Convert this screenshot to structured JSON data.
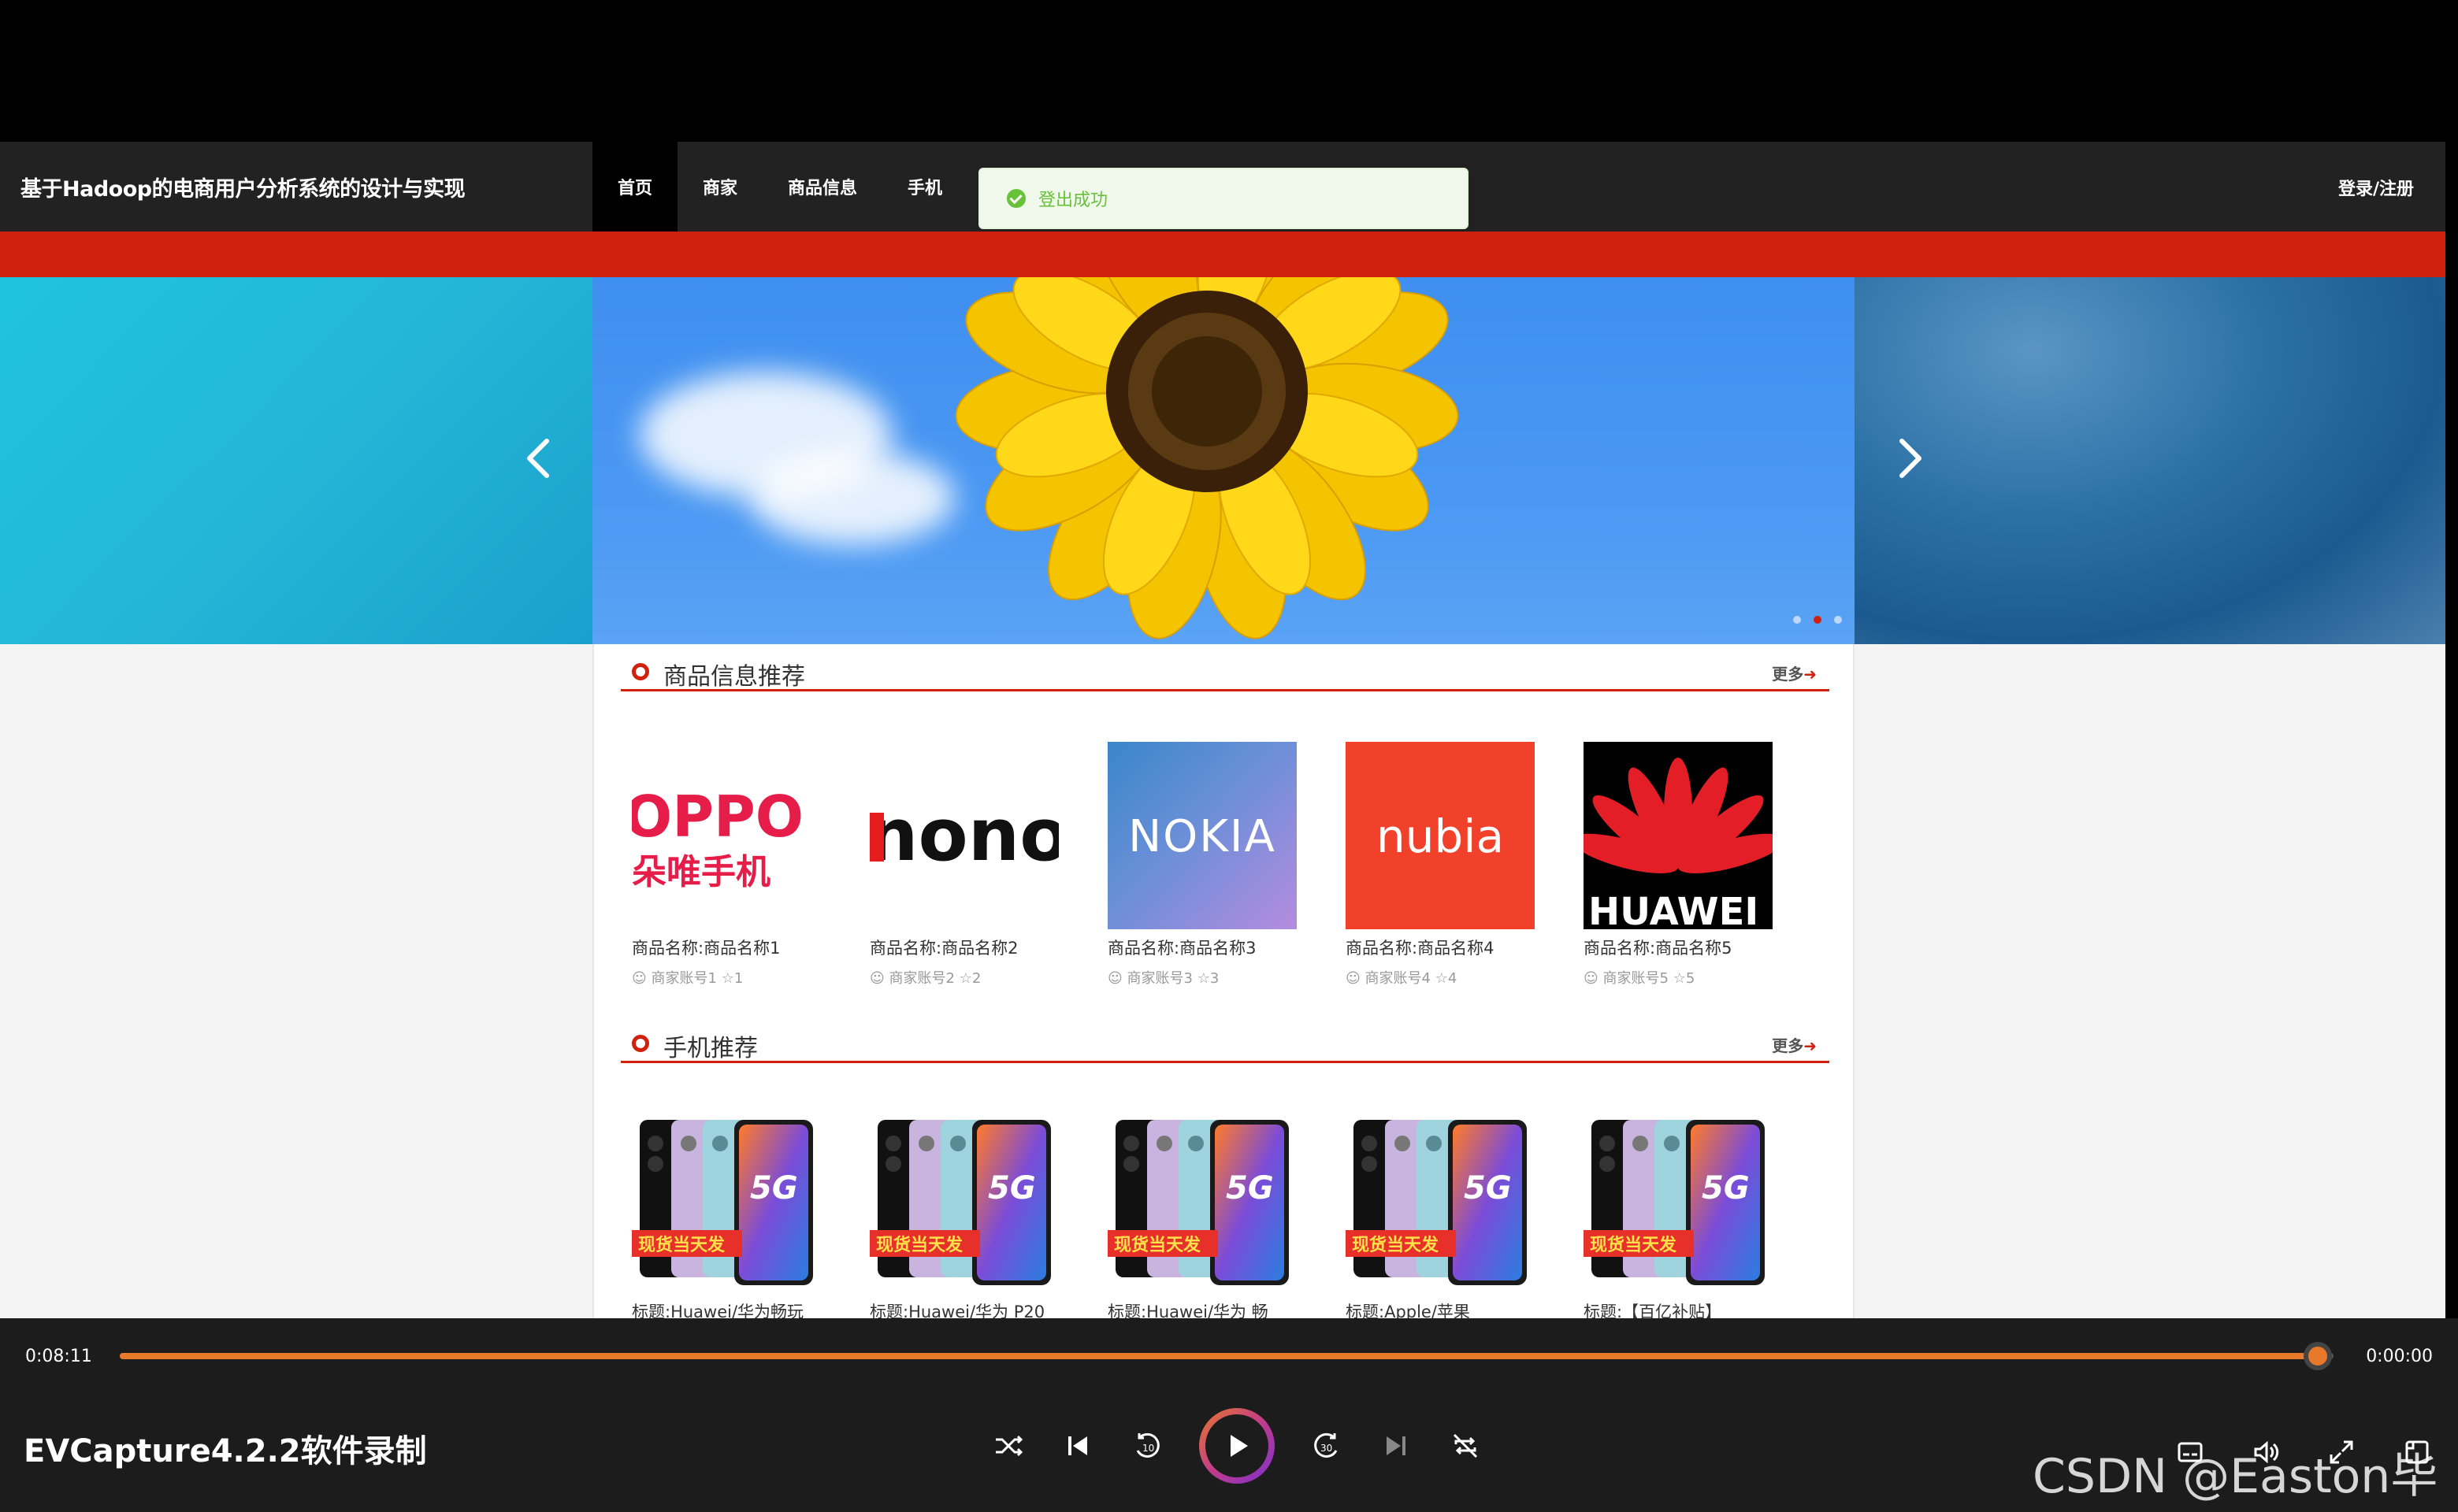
{
  "site": {
    "title": "基于Hadoop的电商用户分析系统的设计与实现",
    "nav": [
      "首页",
      "商家",
      "商品信息",
      "手机"
    ],
    "login": "登录/注册"
  },
  "toast": {
    "text": "登出成功"
  },
  "sections": {
    "products": {
      "title": "商品信息推荐",
      "more": "更多",
      "items": [
        {
          "name": "商品名称:商品名称1",
          "account": "商家账号1",
          "stars": "1",
          "logo": "OPPO"
        },
        {
          "name": "商品名称:商品名称2",
          "account": "商家账号2",
          "stars": "2",
          "logo": "nono"
        },
        {
          "name": "商品名称:商品名称3",
          "account": "商家账号3",
          "stars": "3",
          "logo": "NOKIA"
        },
        {
          "name": "商品名称:商品名称4",
          "account": "商家账号4",
          "stars": "4",
          "logo": "nubia"
        },
        {
          "name": "商品名称:商品名称5",
          "account": "商家账号5",
          "stars": "5",
          "logo": "HUAWEI"
        }
      ]
    },
    "phones": {
      "title": "手机推荐",
      "more": "更多",
      "items": [
        {
          "name": "标题:Huawei/华为畅玩"
        },
        {
          "name": "标题:Huawei/华为 P20"
        },
        {
          "name": "标题:Huawei/华为 畅"
        },
        {
          "name": "标题:Apple/苹果"
        },
        {
          "name": "标题:【百亿补贴】"
        }
      ],
      "badge": "现货当天发",
      "tag5g": "5G"
    }
  },
  "player": {
    "elapsed": "0:08:11",
    "remaining": "0:00:00",
    "progress": 0.993,
    "title": "EVCapture4.2.2软件录制"
  },
  "watermark": "CSDN @Easton毕设",
  "colors": {
    "accent": "#d2200e",
    "success": "#67c23a",
    "player_accent": "#e8782a"
  }
}
